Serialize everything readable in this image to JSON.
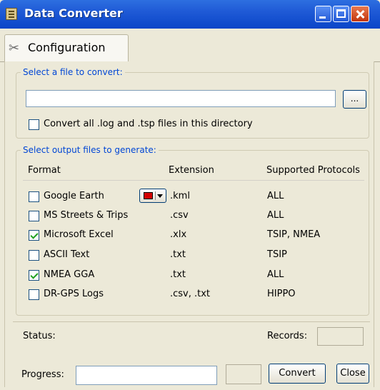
{
  "window": {
    "title": "Data Converter"
  },
  "tabs": [
    {
      "label": "Configuration",
      "icon": "tools-icon"
    }
  ],
  "file_section": {
    "legend": "Select a file to convert:",
    "file_value": "",
    "browse_label": "...",
    "convert_all_label": "Convert all .log and .tsp files in this directory",
    "convert_all_checked": false
  },
  "output_section": {
    "legend": "Select output files to generate:",
    "headers": {
      "format": "Format",
      "extension": "Extension",
      "protocols": "Supported Protocols"
    },
    "rows": [
      {
        "format": "Google Earth",
        "extension": ".kml",
        "protocols": "ALL",
        "checked": false,
        "color": "#d40000"
      },
      {
        "format": "MS Streets & Trips",
        "extension": ".csv",
        "protocols": "ALL",
        "checked": false
      },
      {
        "format": "Microsoft Excel",
        "extension": ".xlx",
        "protocols": "TSIP, NMEA",
        "checked": true
      },
      {
        "format": "ASCII Text",
        "extension": ".txt",
        "protocols": "TSIP",
        "checked": false
      },
      {
        "format": "NMEA GGA",
        "extension": ".txt",
        "protocols": "ALL",
        "checked": true
      },
      {
        "format": "DR-GPS Logs",
        "extension": ".csv, .txt",
        "protocols": "HIPPO",
        "checked": false
      }
    ]
  },
  "status": {
    "status_label": "Status:",
    "status_value": "",
    "records_label": "Records:",
    "records_value": ""
  },
  "progress": {
    "label": "Progress:",
    "value": ""
  },
  "buttons": {
    "convert": "Convert",
    "close": "Close"
  }
}
